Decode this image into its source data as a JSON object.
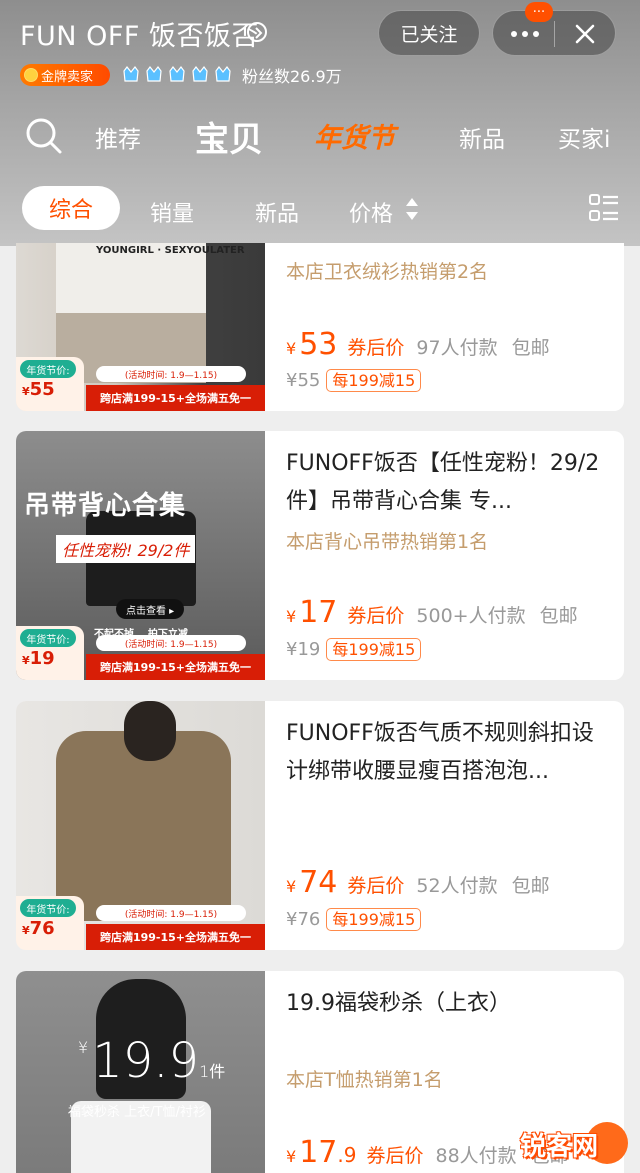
{
  "header": {
    "shop_name": "FUN OFF 饭否饭否",
    "follow_label": "已关注",
    "notification_count": "···",
    "seller_badge": "金牌卖家",
    "fans": "粉丝数26.9万"
  },
  "nav": {
    "tabs": [
      {
        "label": "推荐"
      },
      {
        "label": "宝贝"
      },
      {
        "label": "年货节"
      },
      {
        "label": "新品"
      },
      {
        "label": "买家i"
      }
    ]
  },
  "filters": {
    "items": [
      {
        "label": "综合"
      },
      {
        "label": "销量"
      },
      {
        "label": "新品"
      },
      {
        "label": "价格"
      }
    ]
  },
  "products": [
    {
      "title_partial": "",
      "rank": "本店卫衣绒衫热销第2名",
      "price": "53",
      "price_tag": "券后价",
      "sold": "97人付款",
      "shipping": "包邮",
      "original_price": "¥55",
      "coupon": "每199减15",
      "image_badge_label": "年货节价:",
      "image_badge_price": "55",
      "image_time": "(活动时间: 1.9—1.15)",
      "image_strip": "跨店满199-15+全场满五免一",
      "image_text": "YOUNGIRL · SEXYOULATER"
    },
    {
      "title": "FUNOFF饭否【任性宠粉！29/2件】吊带背心合集 专...",
      "rank": "本店背心吊带热销第1名",
      "price": "17",
      "price_tag": "券后价",
      "sold": "500+人付款",
      "shipping": "包邮",
      "original_price": "¥19",
      "coupon": "每199减15",
      "image_badge_label": "年货节价:",
      "image_badge_price": "19",
      "image_time": "(活动时间: 1.9—1.15)",
      "image_strip": "跨店满199-15+全场满五免一",
      "image_headline": "吊带背心合集",
      "image_sub": "任性宠粉! 29/2件",
      "image_button": "点击查看 ▸",
      "image_tags": "不起不掉    拍下立减"
    },
    {
      "title": "FUNOFF饭否气质不规则斜扣设计绑带收腰显瘦百搭泡泡...",
      "rank": "",
      "price": "74",
      "price_tag": "券后价",
      "sold": "52人付款",
      "shipping": "包邮",
      "original_price": "¥76",
      "coupon": "每199减15",
      "image_badge_label": "年货节价:",
      "image_badge_price": "76",
      "image_time": "(活动时间: 1.9—1.15)",
      "image_strip": "跨店满199-15+全场满五免一"
    },
    {
      "title": "19.9福袋秒杀（上衣）",
      "rank": "本店T恤热销第1名",
      "price": "17",
      "price_decimal": ".9",
      "price_tag": "券后价",
      "sold": "88人付款",
      "shipping": "包邮",
      "image_yen": "¥",
      "image_price": "19.9",
      "image_unit": "1件",
      "image_sub": "福袋秒杀 上衣/T恤/衬衫"
    }
  ],
  "watermark": {
    "text": "锐客网"
  },
  "colors": {
    "accent": "#ff5000",
    "rank": "#c59d6d",
    "festival": "#ff6a00"
  }
}
